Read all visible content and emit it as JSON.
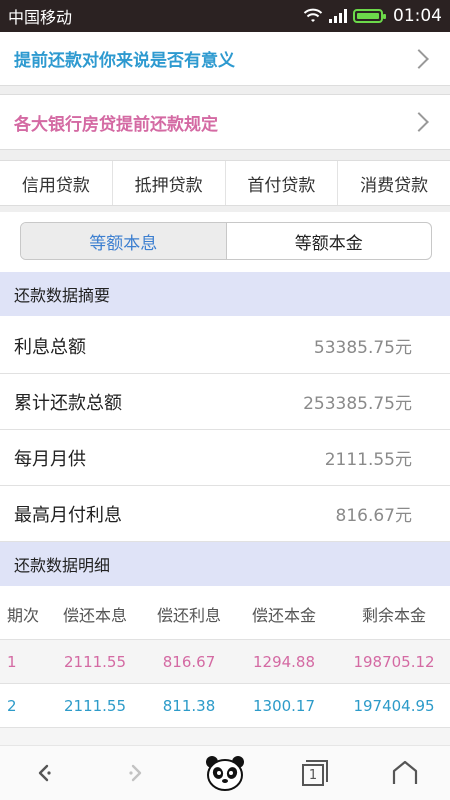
{
  "status": {
    "carrier": "中国移动",
    "time": "01:04"
  },
  "links": [
    {
      "label": "提前还款对你来说是否有意义",
      "color": "#2e9ad0"
    },
    {
      "label": "各大银行房贷提前还款规定",
      "color": "#d46aa3"
    }
  ],
  "tabs": [
    "信用贷款",
    "抵押贷款",
    "首付贷款",
    "消费贷款"
  ],
  "toggle": {
    "active": "等额本息",
    "inactive": "等额本金"
  },
  "summary": {
    "title": "还款数据摘要",
    "rows": [
      {
        "label": "利息总额",
        "value": "53385.75元"
      },
      {
        "label": "累计还款总额",
        "value": "253385.75元"
      },
      {
        "label": "每月月供",
        "value": "2111.55元"
      },
      {
        "label": "最高月付利息",
        "value": "816.67元"
      }
    ]
  },
  "detail": {
    "title": "还款数据明细",
    "headers": [
      "期次",
      "偿还本息",
      "偿还利息",
      "偿还本金",
      "剩余本金"
    ],
    "rows": [
      [
        "1",
        "2111.55",
        "816.67",
        "1294.88",
        "198705.12"
      ],
      [
        "2",
        "2111.55",
        "811.38",
        "1300.17",
        "197404.95"
      ]
    ]
  },
  "bottom_icons": [
    "back-icon",
    "forward-icon",
    "panda-icon",
    "tabs-icon",
    "home-icon"
  ],
  "tab_count": "1"
}
